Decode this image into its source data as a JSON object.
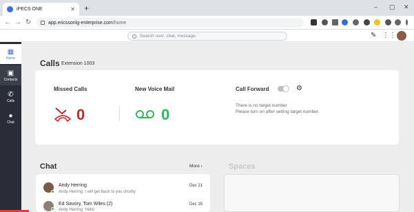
{
  "browser": {
    "tab_title": "iPECS ONE",
    "tab_close": "✕",
    "new_tab": "+",
    "url_host": "app.ericssonlg-enterprise.com",
    "url_path": "/home",
    "min": "–",
    "max": "▢",
    "close": "✕"
  },
  "header": {
    "search_placeholder": "Search user, chat, message."
  },
  "sidebar": {
    "items": [
      {
        "label": "Home",
        "icon": "grid-icon"
      },
      {
        "label": "Contacts",
        "icon": "contacts-icon"
      },
      {
        "label": "Calls",
        "icon": "phone-icon"
      },
      {
        "label": "Chat",
        "icon": "chat-icon"
      }
    ]
  },
  "calls": {
    "title": "Calls",
    "extension": "Extension 1003",
    "missed_label": "Missed Calls",
    "missed_count": "0",
    "voicemail_label": "New Voice Mail",
    "voicemail_count": "0",
    "forward_label": "Call Forward",
    "forward_info_1": "There is no target number.",
    "forward_info_2": "Please turn on after setting target number."
  },
  "chat": {
    "title": "Chat",
    "more": "More",
    "items": [
      {
        "name": "Andy Herring",
        "preview": "Andy Herring: I will get back to you shortly",
        "date": "Dec 21"
      },
      {
        "name": "Ed Savory, Tom Wiles (2)",
        "preview": "Andy Herring: Hello",
        "date": "Dec 15"
      }
    ]
  },
  "spaces": {
    "title": "Spaces"
  },
  "colors": {
    "missed": "#c62828",
    "voicemail": "#2eb85c",
    "sidebar": "#2a2d37",
    "accent": "#4a6fd8"
  }
}
